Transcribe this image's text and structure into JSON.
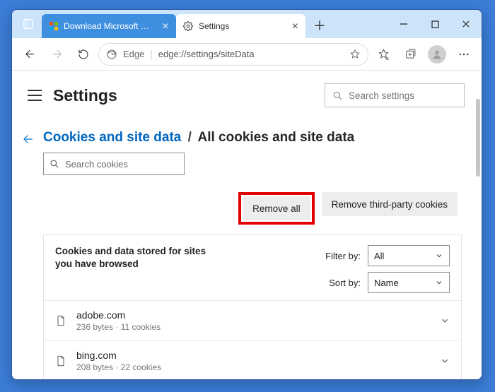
{
  "window": {
    "tabs": [
      {
        "title": "Download Microsoft Edge"
      },
      {
        "title": "Settings"
      }
    ],
    "controls": {
      "min": "—",
      "max": "▢",
      "close": "✕"
    }
  },
  "toolbar": {
    "addr_prefix": "Edge",
    "addr_url": "edge://settings/siteData"
  },
  "header": {
    "title": "Settings",
    "search_placeholder": "Search settings"
  },
  "breadcrumb": {
    "link": "Cookies and site data",
    "sep": "/",
    "current": "All cookies and site data"
  },
  "search_cookies_placeholder": "Search cookies",
  "actions": {
    "remove_all": "Remove all",
    "remove_third_party": "Remove third-party cookies"
  },
  "panel": {
    "description": "Cookies and data stored for sites you have browsed",
    "filter_label": "Filter by:",
    "sort_label": "Sort by:",
    "filter_value": "All",
    "sort_value": "Name"
  },
  "sites": [
    {
      "domain": "adobe.com",
      "meta": "236 bytes · 11 cookies"
    },
    {
      "domain": "bing.com",
      "meta": "208 bytes · 22 cookies"
    }
  ]
}
